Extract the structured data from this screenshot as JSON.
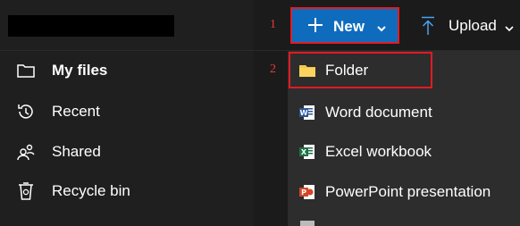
{
  "annotations": [
    "1",
    "2"
  ],
  "sidebar": {
    "items": [
      {
        "label": "My files",
        "icon": "folder-icon",
        "active": true
      },
      {
        "label": "Recent",
        "icon": "history-icon",
        "active": false
      },
      {
        "label": "Shared",
        "icon": "people-icon",
        "active": false
      },
      {
        "label": "Recycle bin",
        "icon": "recycle-bin-icon",
        "active": false
      }
    ]
  },
  "toolbar": {
    "new_label": "New",
    "upload_label": "Upload"
  },
  "dropdown": {
    "items": [
      {
        "label": "Folder",
        "icon": "folder-yellow-icon"
      },
      {
        "label": "Word document",
        "icon": "word-icon"
      },
      {
        "label": "Excel workbook",
        "icon": "excel-icon"
      },
      {
        "label": "PowerPoint presentation",
        "icon": "powerpoint-icon"
      }
    ]
  },
  "colors": {
    "accent": "#0f6cbd",
    "highlight": "#e11b22",
    "folder": "#f8c74a",
    "word": "#2b5797",
    "excel": "#1e7145",
    "powerpoint": "#d24726"
  }
}
